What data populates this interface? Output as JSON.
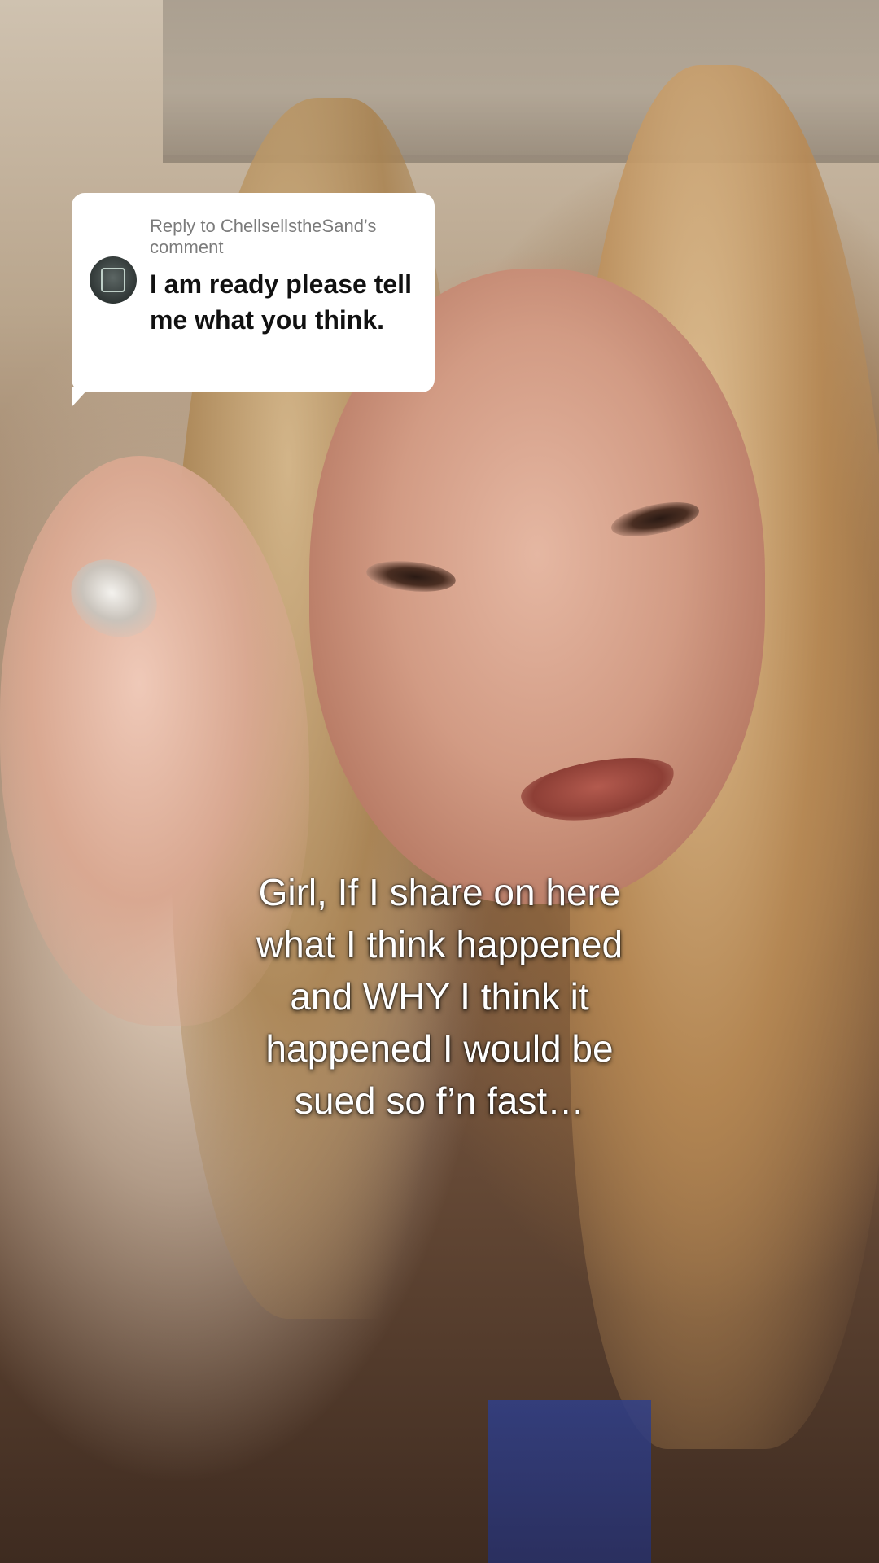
{
  "reply_card": {
    "header": "Reply to ChellsellstheSand’s comment",
    "comment": "I am ready please tell me what you think."
  },
  "caption": {
    "text": "Girl, If I share on here\nwhat I think happened\nand WHY I think it\nhappened I would be\nsued so f’n fast…"
  },
  "icons": {
    "avatar": "commenter-avatar-icon"
  },
  "colors": {
    "card_background": "#ffffff",
    "header_text": "#7b7b7b",
    "comment_text": "#111111",
    "caption_text": "#ffffff"
  }
}
